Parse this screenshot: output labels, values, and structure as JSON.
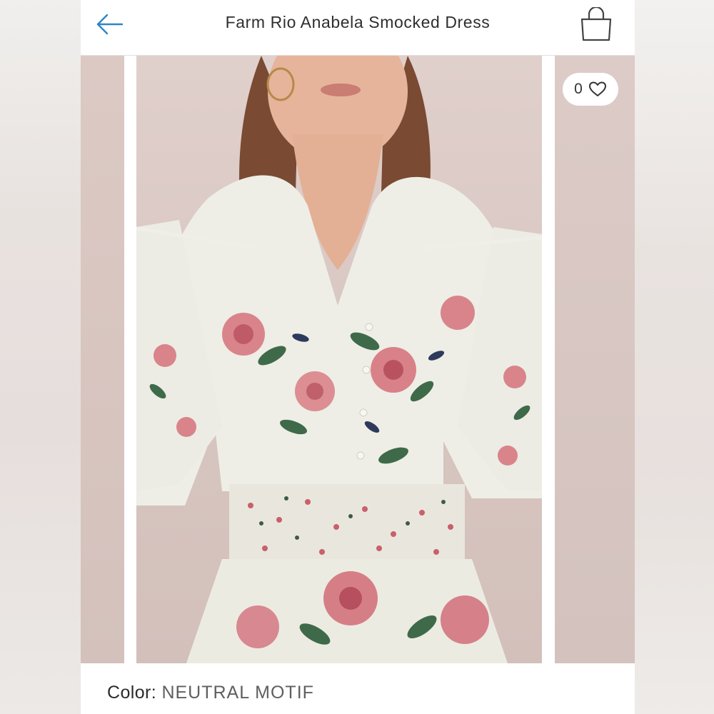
{
  "header": {
    "title": "Farm Rio Anabela Smocked Dress",
    "back_icon": "arrow-left-icon",
    "bag_icon": "shopping-bag-icon"
  },
  "gallery": {
    "like_count": "0",
    "like_icon": "heart-outline-icon"
  },
  "details": {
    "color_label": "Color:",
    "color_value": "NEUTRAL MOTIF"
  },
  "colors": {
    "accent": "#2f86c2",
    "photo_background": "#d8c6c1",
    "text_primary": "#2c2c2c"
  }
}
